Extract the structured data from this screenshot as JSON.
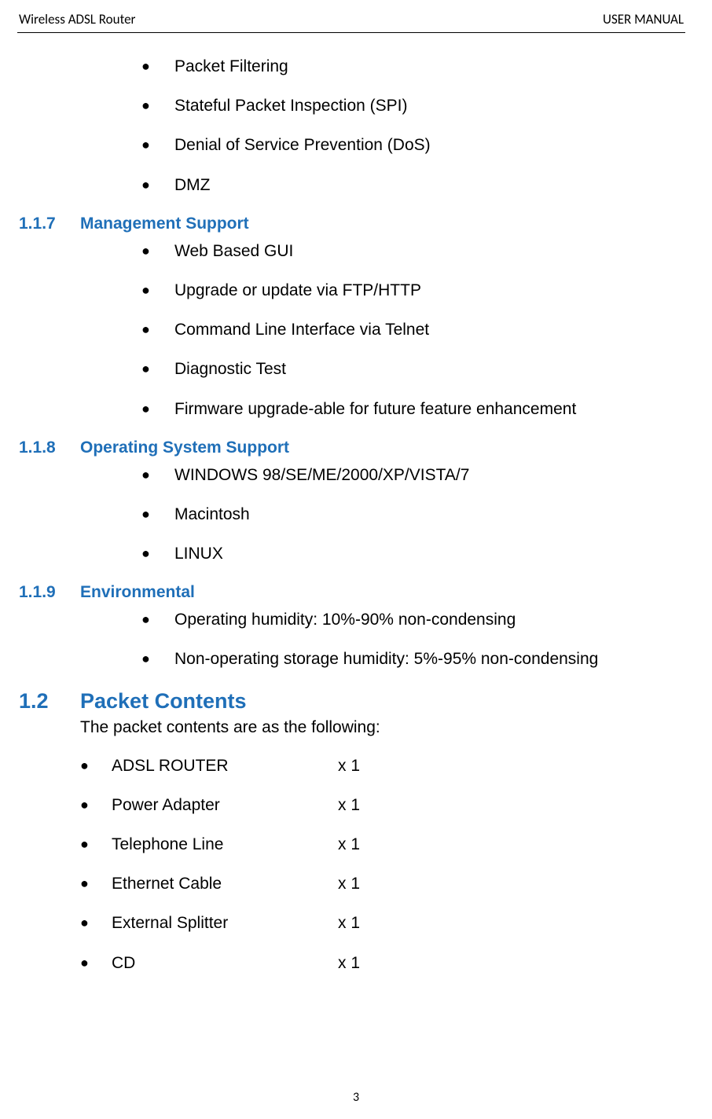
{
  "header": {
    "left": "Wireless ADSL Router",
    "right": "USER MANUAL"
  },
  "section_116_cont": {
    "items": [
      "Packet Filtering",
      "Stateful Packet Inspection (SPI)",
      "Denial of Service Prevention (DoS)",
      "DMZ"
    ]
  },
  "section_117": {
    "number": "1.1.7",
    "title": "Management Support",
    "items": [
      "Web Based GUI",
      "Upgrade or update via FTP/HTTP",
      "Command Line Interface via Telnet",
      "Diagnostic Test",
      "Firmware upgrade-able for future feature enhancement"
    ]
  },
  "section_118": {
    "number": "1.1.8",
    "title": "Operating System Support",
    "items": [
      "WINDOWS 98/SE/ME/2000/XP/VISTA/7",
      "Macintosh",
      "LINUX"
    ]
  },
  "section_119": {
    "number": "1.1.9",
    "title": "Environmental",
    "items": [
      "Operating humidity: 10%-90% non-condensing",
      "Non-operating storage humidity: 5%-95% non-condensing"
    ]
  },
  "section_12": {
    "number": "1.2",
    "title": "Packet Contents",
    "intro": "The packet contents are as the following:",
    "items": [
      {
        "name": "ADSL ROUTER",
        "qty": "x 1"
      },
      {
        "name": "Power Adapter",
        "qty": "x 1"
      },
      {
        "name": "Telephone Line",
        "qty": "x 1"
      },
      {
        "name": "Ethernet Cable",
        "qty": "x 1"
      },
      {
        "name": "External Splitter",
        "qty": "x 1"
      },
      {
        "name": "CD",
        "qty": "x 1"
      }
    ]
  },
  "page_number": "3"
}
